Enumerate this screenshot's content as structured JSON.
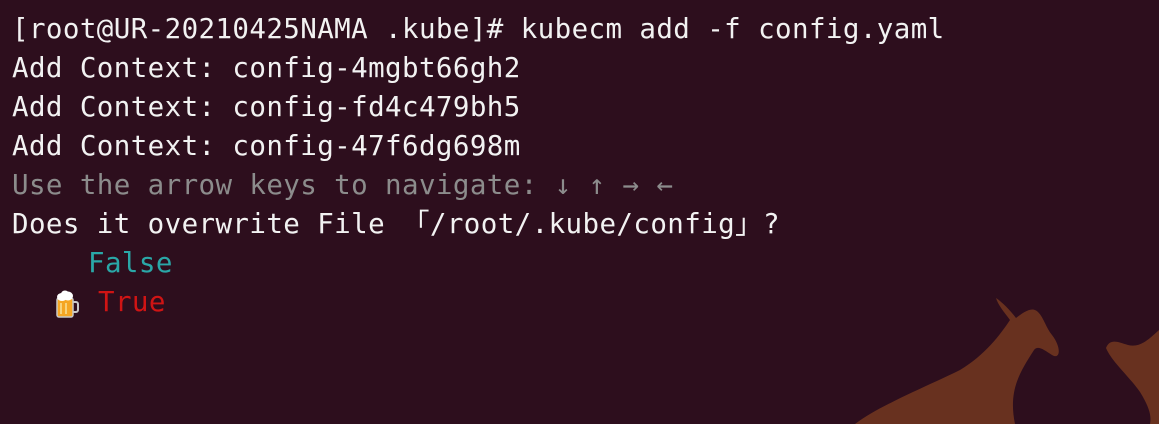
{
  "terminal": {
    "prompt": "[root@UR-20210425NAMA .kube]# ",
    "command": "kubecm add -f config.yaml",
    "contexts_added": [
      "Add Context: config-4mgbt66gh2",
      "Add Context: config-fd4c479bh5",
      "Add Context: config-47f6dg698m"
    ],
    "hint": "Use the arrow keys to navigate: ↓ ↑ → ←",
    "question": "Does it overwrite File 「/root/.kube/config」?",
    "options": [
      {
        "label": "False",
        "selected": false
      },
      {
        "label": "True",
        "selected": true
      }
    ],
    "cursor_icon": "beer-mug-icon"
  },
  "colors": {
    "background": "#2d0e1d",
    "text": "#f2f2f2",
    "hint": "#8c8c8c",
    "option_unselected": "#2aa7a7",
    "option_selected": "#d01414",
    "wallpaper_art": "#6b3420"
  }
}
